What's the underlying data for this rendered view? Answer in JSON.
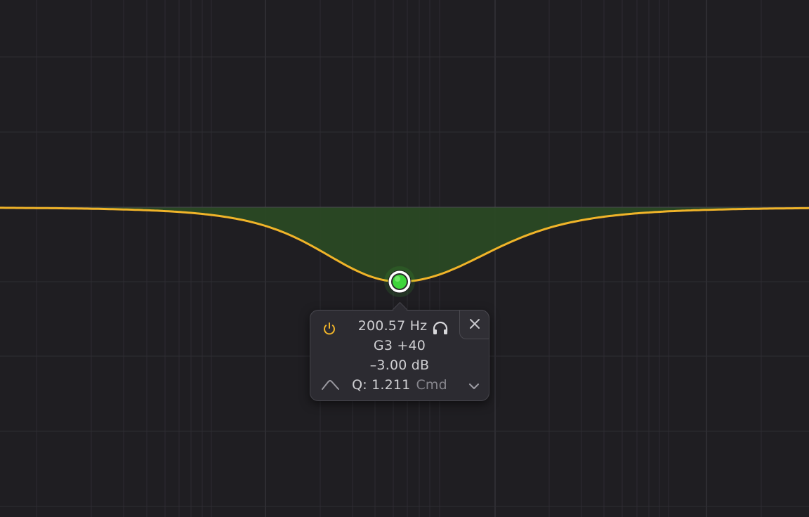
{
  "colors": {
    "background": "#1f1e22",
    "curve": "#f0b429",
    "fill": "#2a4a24",
    "node": "#3ed43b",
    "power_on": "#f0b429"
  },
  "band": {
    "frequency": "200.57 Hz",
    "note": "G3 +40",
    "gain": "–3.00 dB",
    "q_label": "Q: 1.211",
    "q_modifier": "Cmd",
    "shape": "bell",
    "enabled": true
  },
  "icons": {
    "power": "power-icon",
    "solo": "headphones-icon",
    "close": "close-icon",
    "shape": "bell-shape-icon",
    "menu": "chevron-down-icon",
    "node": "band-node"
  }
}
